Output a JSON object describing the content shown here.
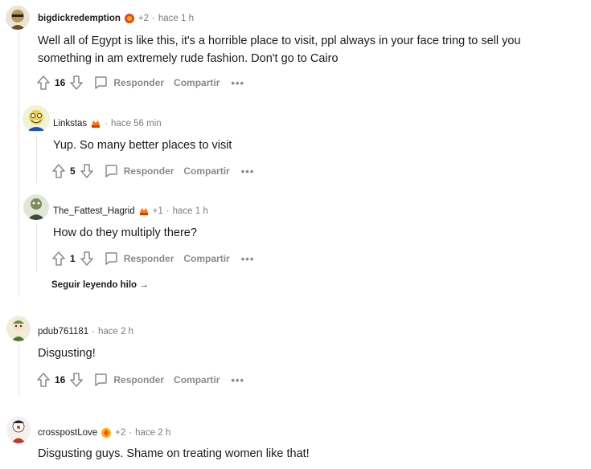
{
  "comments": [
    {
      "username": "bigdickredemption",
      "plus": "+2",
      "time": "hace 1 h",
      "body_line1": "Well all of Egypt is like this, it's a horrible place to visit, ppl always in your face tring to sell you",
      "body_line2": "something in am extremely rude fashion. Don't go to Cairo",
      "score": "16"
    },
    {
      "username": "Linkstas",
      "time": "hace 56 min",
      "body_line1": "Yup. So many better places to visit",
      "score": "5"
    },
    {
      "username": "The_Fattest_Hagrid",
      "plus": "+1",
      "time": "hace 1 h",
      "body_line1": "How do they multiply there?",
      "score": "1"
    },
    {
      "username": "pdub761181",
      "time": "hace 2 h",
      "body_line1": "Disgusting!",
      "score": "16"
    },
    {
      "username": "crosspostLove",
      "plus": "+2",
      "time": "hace 2 h",
      "body_line1": "Disgusting guys. Shame on treating women like that!"
    }
  ],
  "actions": {
    "reply": "Responder",
    "share": "Compartir",
    "more": "•••"
  },
  "separator": "·",
  "continue_thread": "Seguir leyendo hilo →",
  "icons": {
    "upvote": "upvote-icon",
    "downvote": "downvote-icon",
    "reply": "comment-bubble-icon",
    "more": "more-options-icon"
  }
}
